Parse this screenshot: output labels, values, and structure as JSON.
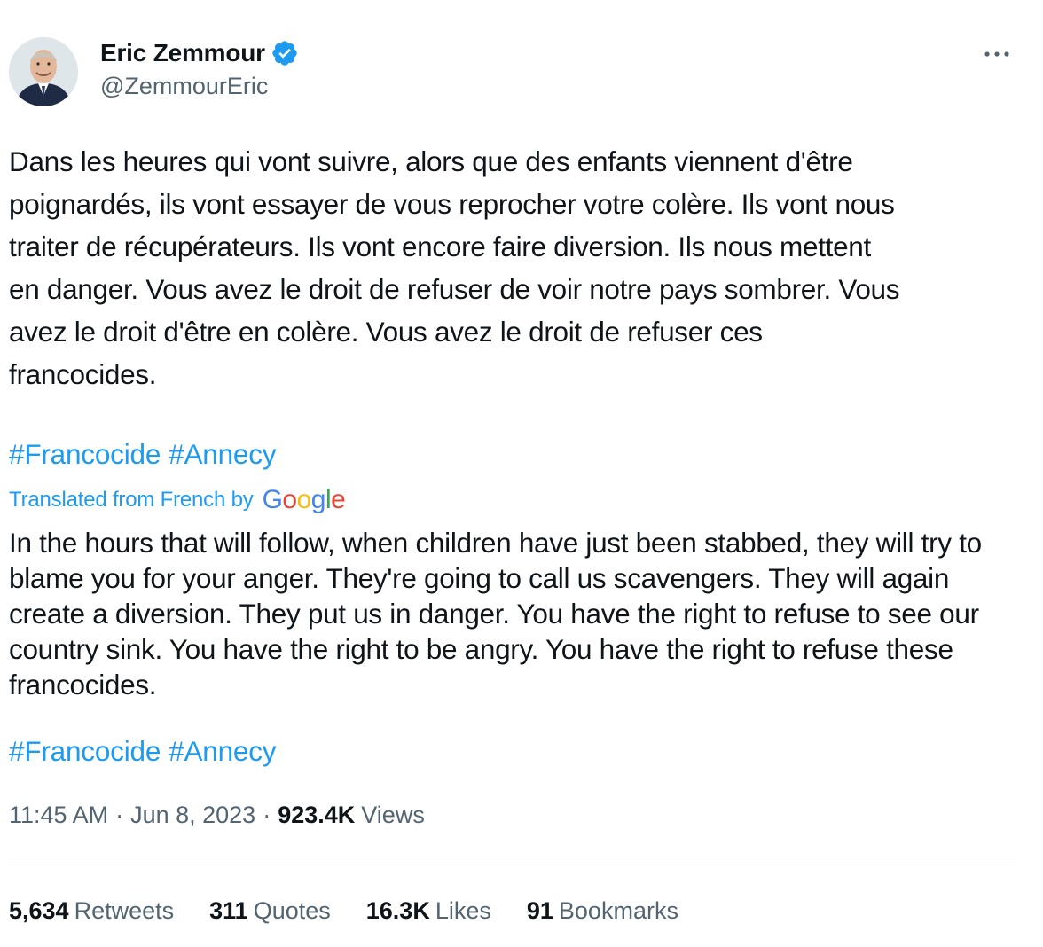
{
  "author": {
    "display_name": "Eric Zemmour",
    "handle": "@ZemmourEric",
    "verified": true,
    "avatar_icon": "profile-photo"
  },
  "more_icon": "ellipsis-icon",
  "tweet": {
    "text_fr": "Dans les heures qui vont suivre, alors que des enfants viennent d'être\npoignardés, ils vont essayer de vous reprocher votre colère. Ils vont nous\ntraiter de récupérateurs. Ils vont encore faire diversion. Ils nous mettent\nen danger. Vous avez le droit de refuser de voir notre pays sombrer. Vous\navez le droit d'être en colère. Vous avez le droit de refuser ces\nfrancocides.",
    "hashtags_fr": [
      "#Francocide",
      "#Annecy"
    ],
    "translated_label": "Translated from French by",
    "translator_logo": "Google",
    "text_en": "In the hours that will follow, when children have just been stabbed, they will try to blame you for your anger. They're going to call us scavengers. They will again create a diversion. They put us in danger. You have the right to refuse to see our country sink. You have the right to be angry. You have the right to refuse these francocides.",
    "hashtags_en": [
      "#Francocide",
      "#Annecy"
    ]
  },
  "meta": {
    "time": "11:45 AM",
    "separator": "·",
    "date": "Jun 8, 2023",
    "views_count": "923.4K",
    "views_label": "Views"
  },
  "stats": {
    "retweets": {
      "count": "5,634",
      "label": "Retweets"
    },
    "quotes": {
      "count": "311",
      "label": "Quotes"
    },
    "likes": {
      "count": "16.3K",
      "label": "Likes"
    },
    "bookmarks": {
      "count": "91",
      "label": "Bookmarks"
    }
  },
  "colors": {
    "link": "#1d9bf0",
    "text": "#0f1419",
    "secondary": "#536471",
    "verified": "#1d9bf0"
  }
}
